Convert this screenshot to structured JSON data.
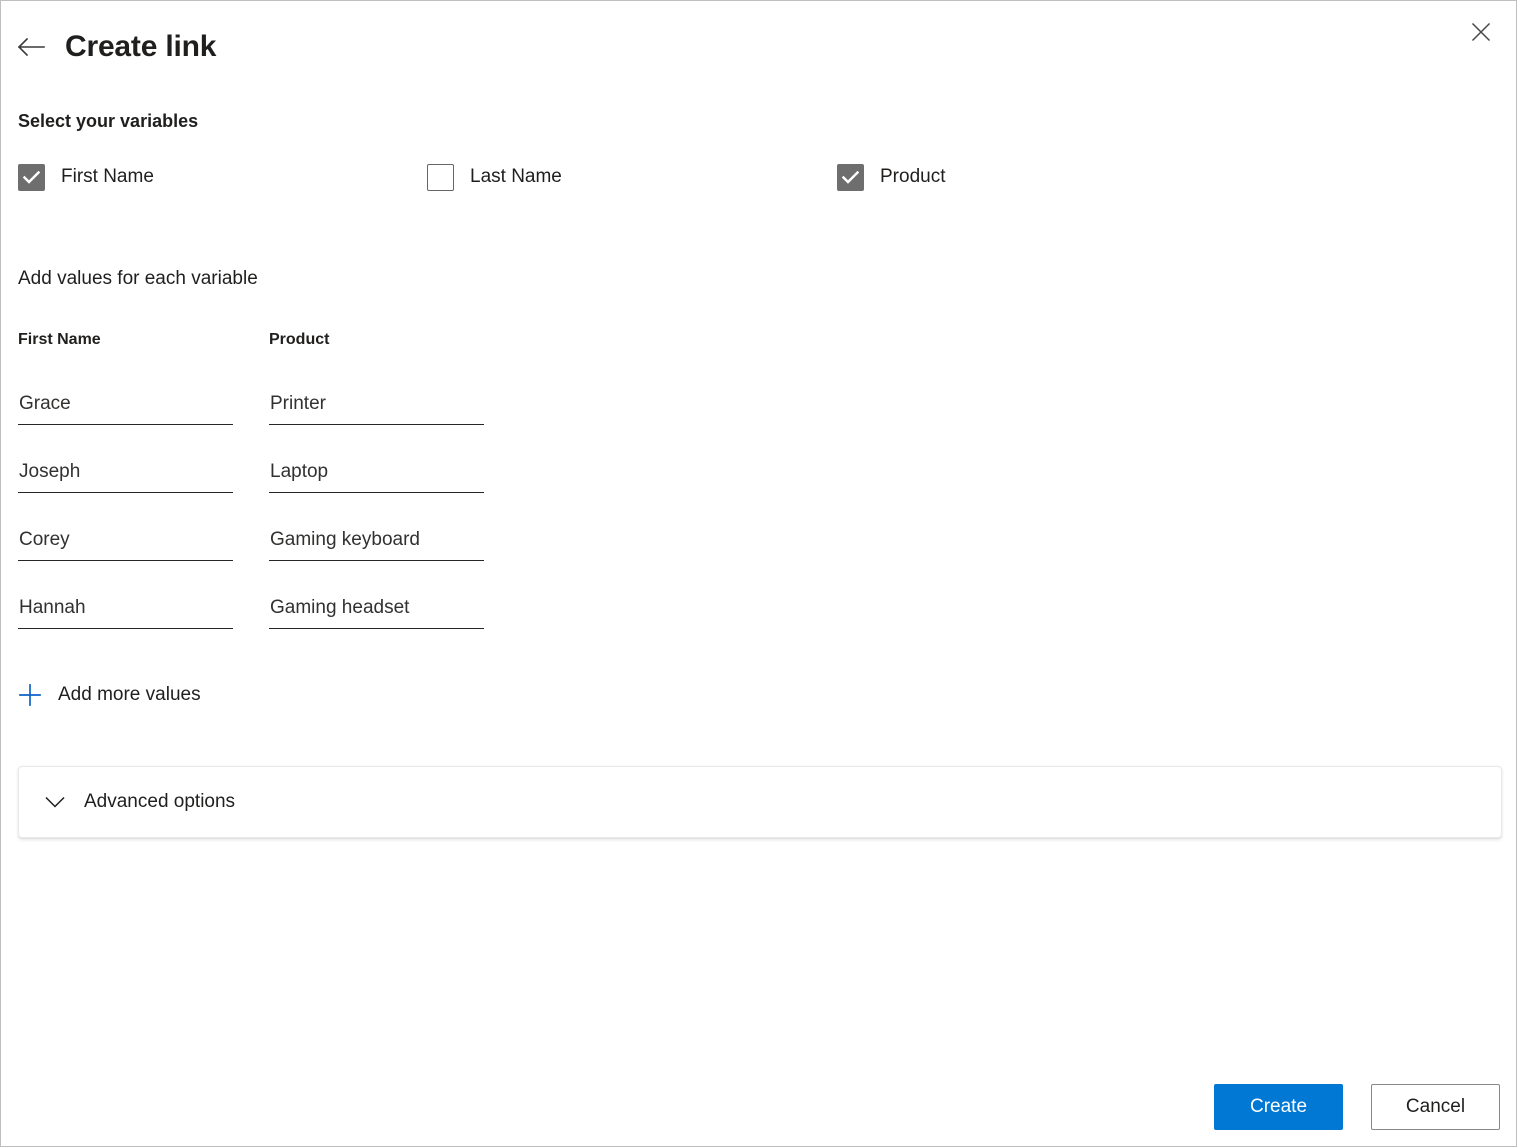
{
  "header": {
    "title": "Create link",
    "back_icon": "arrow-left-icon",
    "close_icon": "close-icon"
  },
  "variables_section": {
    "heading": "Select your variables",
    "items": [
      {
        "label": "First Name",
        "checked": true
      },
      {
        "label": "Last Name",
        "checked": false
      },
      {
        "label": "Product",
        "checked": true
      }
    ]
  },
  "values_section": {
    "heading": "Add values for each variable",
    "columns": [
      {
        "header": "First Name",
        "values": [
          "Grace",
          "Joseph",
          "Corey",
          "Hannah"
        ]
      },
      {
        "header": "Product",
        "values": [
          "Printer",
          "Laptop",
          "Gaming keyboard",
          "Gaming headset"
        ]
      }
    ],
    "add_more_label": "Add more values",
    "add_more_icon": "plus-icon"
  },
  "advanced": {
    "label": "Advanced options",
    "chevron_icon": "chevron-down-icon",
    "expanded": false
  },
  "footer": {
    "primary_label": "Create",
    "secondary_label": "Cancel"
  },
  "colors": {
    "accent": "#0078d4",
    "checkbox_checked": "#6e6e6e",
    "text": "#201f1e",
    "border": "#8a8886"
  }
}
